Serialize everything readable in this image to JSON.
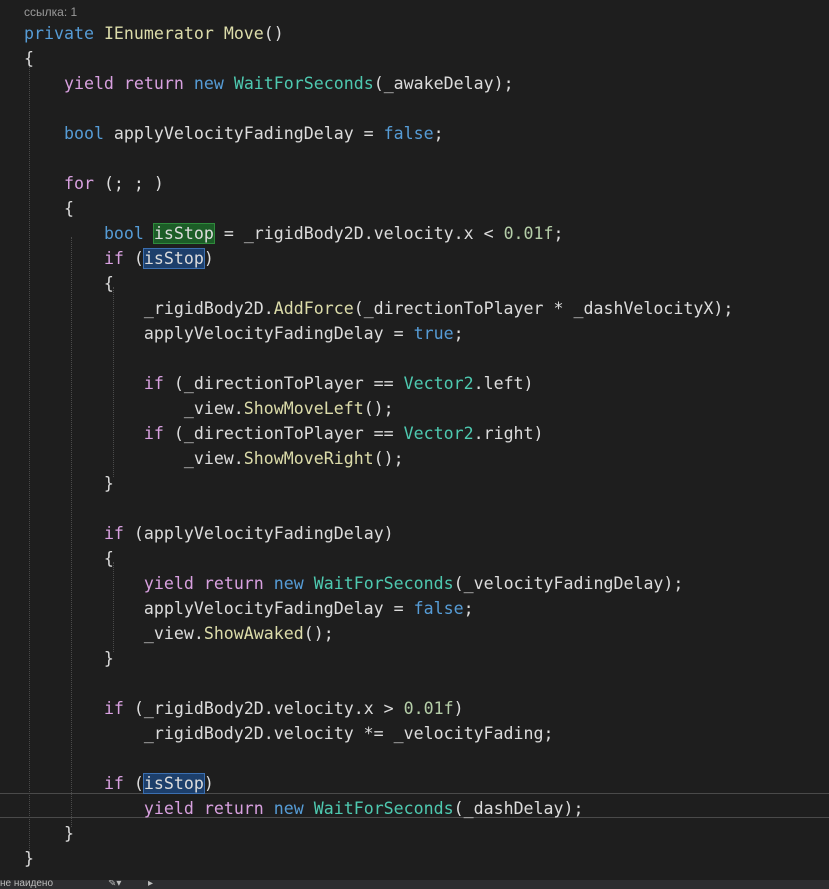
{
  "codelens": {
    "references": "ссылка: 1"
  },
  "code": {
    "lines": [
      [
        {
          "t": "private ",
          "c": "kw"
        },
        {
          "t": "IEnumerator ",
          "c": "method"
        },
        {
          "t": "Move",
          "c": "method"
        },
        {
          "t": "()",
          "c": "id"
        }
      ],
      [
        {
          "t": "{",
          "c": "id"
        }
      ],
      [
        {
          "t": "    "
        },
        {
          "t": "yield ",
          "c": "ctl"
        },
        {
          "t": "return ",
          "c": "ctl"
        },
        {
          "t": "new ",
          "c": "kw"
        },
        {
          "t": "WaitForSeconds",
          "c": "type"
        },
        {
          "t": "(_awakeDelay);",
          "c": "id"
        }
      ],
      [],
      [
        {
          "t": "    "
        },
        {
          "t": "bool ",
          "c": "kw"
        },
        {
          "t": "applyVelocityFadingDelay = ",
          "c": "id"
        },
        {
          "t": "false",
          "c": "kw"
        },
        {
          "t": ";",
          "c": "id"
        }
      ],
      [],
      [
        {
          "t": "    "
        },
        {
          "t": "for ",
          "c": "ctl"
        },
        {
          "t": "(; ; )",
          "c": "id"
        }
      ],
      [
        {
          "t": "    {",
          "c": "id"
        }
      ],
      [
        {
          "t": "        "
        },
        {
          "t": "bool ",
          "c": "kw"
        },
        {
          "t": "isStop",
          "c": "id",
          "h": "def"
        },
        {
          "t": " = _rigidBody2D.velocity.x < ",
          "c": "id"
        },
        {
          "t": "0.01f",
          "c": "num"
        },
        {
          "t": ";",
          "c": "id"
        }
      ],
      [
        {
          "t": "        "
        },
        {
          "t": "if ",
          "c": "ctl"
        },
        {
          "t": "(",
          "c": "id"
        },
        {
          "t": "isStop",
          "c": "id",
          "h": "ref"
        },
        {
          "t": ")",
          "c": "id"
        }
      ],
      [
        {
          "t": "        {",
          "c": "id"
        }
      ],
      [
        {
          "t": "            _rigidBody2D.",
          "c": "id"
        },
        {
          "t": "AddForce",
          "c": "method"
        },
        {
          "t": "(_directionToPlayer * _dashVelocityX);",
          "c": "id"
        }
      ],
      [
        {
          "t": "            applyVelocityFadingDelay = ",
          "c": "id"
        },
        {
          "t": "true",
          "c": "kw"
        },
        {
          "t": ";",
          "c": "id"
        }
      ],
      [],
      [
        {
          "t": "            "
        },
        {
          "t": "if ",
          "c": "ctl"
        },
        {
          "t": "(_directionToPlayer == ",
          "c": "id"
        },
        {
          "t": "Vector2",
          "c": "type"
        },
        {
          "t": ".left)",
          "c": "id"
        }
      ],
      [
        {
          "t": "                _view.",
          "c": "id"
        },
        {
          "t": "ShowMoveLeft",
          "c": "method"
        },
        {
          "t": "();",
          "c": "id"
        }
      ],
      [
        {
          "t": "            "
        },
        {
          "t": "if ",
          "c": "ctl"
        },
        {
          "t": "(_directionToPlayer == ",
          "c": "id"
        },
        {
          "t": "Vector2",
          "c": "type"
        },
        {
          "t": ".right)",
          "c": "id"
        }
      ],
      [
        {
          "t": "                _view.",
          "c": "id"
        },
        {
          "t": "ShowMoveRight",
          "c": "method"
        },
        {
          "t": "();",
          "c": "id"
        }
      ],
      [
        {
          "t": "        }",
          "c": "id"
        }
      ],
      [],
      [
        {
          "t": "        "
        },
        {
          "t": "if ",
          "c": "ctl"
        },
        {
          "t": "(applyVelocityFadingDelay)",
          "c": "id"
        }
      ],
      [
        {
          "t": "        {",
          "c": "id"
        }
      ],
      [
        {
          "t": "            "
        },
        {
          "t": "yield ",
          "c": "ctl"
        },
        {
          "t": "return ",
          "c": "ctl"
        },
        {
          "t": "new ",
          "c": "kw"
        },
        {
          "t": "WaitForSeconds",
          "c": "type"
        },
        {
          "t": "(_velocityFadingDelay);",
          "c": "id"
        }
      ],
      [
        {
          "t": "            applyVelocityFadingDelay = ",
          "c": "id"
        },
        {
          "t": "false",
          "c": "kw"
        },
        {
          "t": ";",
          "c": "id"
        }
      ],
      [
        {
          "t": "            _view.",
          "c": "id"
        },
        {
          "t": "ShowAwaked",
          "c": "method"
        },
        {
          "t": "();",
          "c": "id"
        }
      ],
      [
        {
          "t": "        }",
          "c": "id"
        }
      ],
      [],
      [
        {
          "t": "        "
        },
        {
          "t": "if ",
          "c": "ctl"
        },
        {
          "t": "(_rigidBody2D.velocity.x > ",
          "c": "id"
        },
        {
          "t": "0.01f",
          "c": "num"
        },
        {
          "t": ")",
          "c": "id"
        }
      ],
      [
        {
          "t": "            _rigidBody2D.velocity *= _velocityFading;",
          "c": "id"
        }
      ],
      [],
      [
        {
          "t": "        "
        },
        {
          "t": "if ",
          "c": "ctl"
        },
        {
          "t": "(",
          "c": "id"
        },
        {
          "t": "isStop",
          "c": "id",
          "h": "ref"
        },
        {
          "t": ")",
          "c": "id"
        }
      ],
      [
        {
          "t": "            "
        },
        {
          "t": "yield ",
          "c": "ctl"
        },
        {
          "t": "return ",
          "c": "ctl"
        },
        {
          "t": "new ",
          "c": "kw"
        },
        {
          "t": "WaitForSeconds",
          "c": "type"
        },
        {
          "t": "(_dashDelay);",
          "c": "id"
        }
      ],
      [
        {
          "t": "    }",
          "c": "id"
        }
      ],
      [
        {
          "t": "}",
          "c": "id"
        }
      ]
    ]
  },
  "colors": {
    "background": "#1e1e1e",
    "keyword": "#569cd6",
    "control": "#d8a0df",
    "type": "#4ec9b0",
    "method": "#dcdcaa",
    "number": "#b5cea8",
    "identifier": "#dcdcdc"
  },
  "status": {
    "message": "не найдено",
    "icon": "wrench-icon"
  }
}
